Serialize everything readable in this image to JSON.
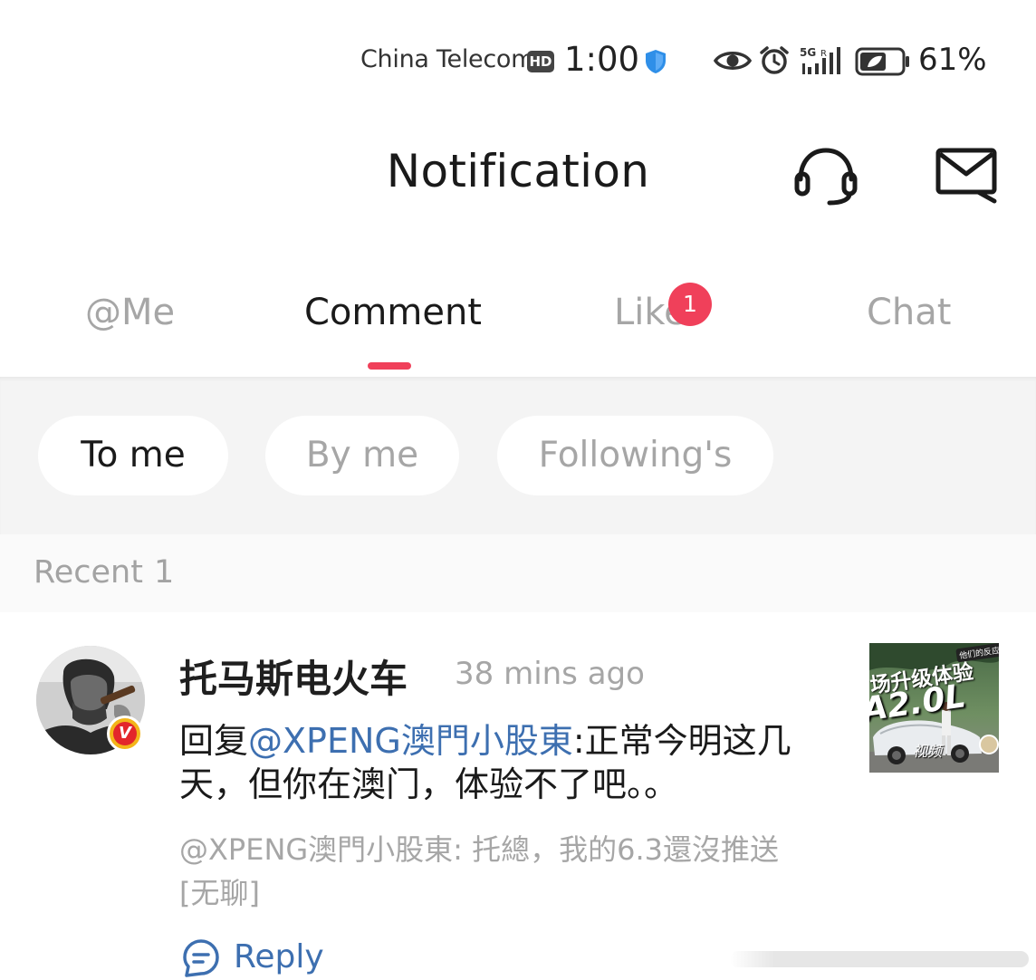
{
  "status_bar": {
    "carrier": "China Telecom",
    "hd_badge": "HD",
    "time": "1:00",
    "signal_label": "5G",
    "battery_percent": "61%",
    "icons": [
      "shield-icon",
      "eye-icon",
      "alarm-icon",
      "signal-icon",
      "battery-icon"
    ]
  },
  "header": {
    "title": "Notification",
    "icons": [
      "headset-icon",
      "mail-icon"
    ]
  },
  "tabs": {
    "items": [
      {
        "label": "@Me",
        "active": false
      },
      {
        "label": "Comment",
        "active": true
      },
      {
        "label": "Like",
        "active": false,
        "badge": "1"
      },
      {
        "label": "Chat",
        "active": false
      }
    ]
  },
  "filters": {
    "items": [
      {
        "label": "To me",
        "active": true
      },
      {
        "label": "By me",
        "active": false
      },
      {
        "label": "Following's",
        "active": false
      }
    ]
  },
  "recent": {
    "label": "Recent",
    "count": "1"
  },
  "comments": [
    {
      "username": "托马斯电火车",
      "verified_badge": "V",
      "time": "38  mins ago",
      "body_prefix": "回复",
      "mention": "@XPENG澳門小股東",
      "body_suffix": ":正常今明这几天，但你在澳门，体验不了吧。。",
      "quote": "@XPENG澳門小股東: 托總，我的6.3還沒推送[无聊]",
      "reply_label": "Reply",
      "thumbnail": {
        "line1": "场升级体验",
        "line2": "A2.0L",
        "tag": "他们的反应是?",
        "sig": "视频"
      }
    }
  ],
  "colors": {
    "accent": "#f0405a",
    "link": "#3d6fb0",
    "muted_text": "#a6a6a6",
    "filter_bg": "#f4f4f4"
  }
}
